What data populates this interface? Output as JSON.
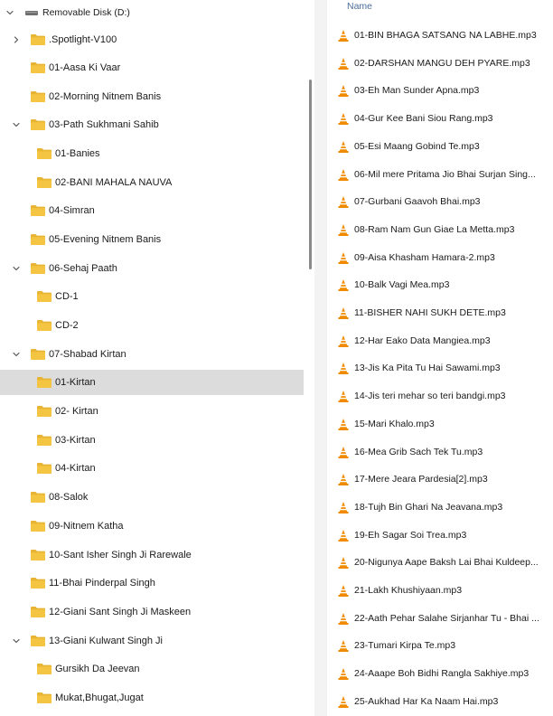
{
  "colors": {
    "folder_yellow": "#f4c542",
    "folder_tab": "#e8b433",
    "selection_bg": "#dcdcdc",
    "vlc_orange": "#f08a00",
    "header_text": "#4a6e9a"
  },
  "nav": {
    "items": [
      {
        "label": "Removable Disk (D:)",
        "icon": "drive-icon",
        "chevron": "expanded"
      },
      {
        "label": ".Spotlight-V100",
        "icon": "folder-icon",
        "chevron": "collapsed"
      },
      {
        "label": "01-Aasa Ki Vaar",
        "icon": "folder-icon",
        "chevron": "none"
      },
      {
        "label": "02-Morning Nitnem Banis",
        "icon": "folder-icon",
        "chevron": "none"
      },
      {
        "label": "03-Path Sukhmani Sahib",
        "icon": "folder-icon",
        "chevron": "expanded"
      },
      {
        "label": "01-Banies",
        "icon": "folder-icon",
        "chevron": "none"
      },
      {
        "label": "02-BANI MAHALA NAUVA",
        "icon": "folder-icon",
        "chevron": "none"
      },
      {
        "label": "04-Simran",
        "icon": "folder-icon",
        "chevron": "none"
      },
      {
        "label": "05-Evening Nitnem Banis",
        "icon": "folder-icon",
        "chevron": "none"
      },
      {
        "label": "06-Sehaj Paath",
        "icon": "folder-icon",
        "chevron": "expanded"
      },
      {
        "label": "CD-1",
        "icon": "folder-icon",
        "chevron": "none"
      },
      {
        "label": "CD-2",
        "icon": "folder-icon",
        "chevron": "none"
      },
      {
        "label": "07-Shabad Kirtan",
        "icon": "folder-icon",
        "chevron": "expanded"
      },
      {
        "label": "01-Kirtan",
        "icon": "folder-icon",
        "chevron": "none",
        "selected": true
      },
      {
        "label": "02- Kirtan",
        "icon": "folder-icon",
        "chevron": "none"
      },
      {
        "label": "03-Kirtan",
        "icon": "folder-icon",
        "chevron": "none"
      },
      {
        "label": "04-Kirtan",
        "icon": "folder-icon",
        "chevron": "none"
      },
      {
        "label": "08-Salok",
        "icon": "folder-icon",
        "chevron": "none"
      },
      {
        "label": "09-Nitnem Katha",
        "icon": "folder-icon",
        "chevron": "none"
      },
      {
        "label": "10-Sant Isher Singh Ji Rarewale",
        "icon": "folder-icon",
        "chevron": "none"
      },
      {
        "label": "11-Bhai Pinderpal Singh",
        "icon": "folder-icon",
        "chevron": "none"
      },
      {
        "label": "12-Giani Sant Singh Ji Maskeen",
        "icon": "folder-icon",
        "chevron": "none"
      },
      {
        "label": "13-Giani Kulwant Singh Ji",
        "icon": "folder-icon",
        "chevron": "expanded"
      },
      {
        "label": "Gursikh Da Jeevan",
        "icon": "folder-icon",
        "chevron": "none"
      },
      {
        "label": "Mukat,Bhugat,Jugat",
        "icon": "folder-icon",
        "chevron": "none"
      }
    ]
  },
  "files": {
    "column_name": "Name",
    "icon": "vlc-icon",
    "items": [
      "01-BIN BHAGA SATSANG NA LABHE.mp3",
      "02-DARSHAN MANGU DEH PYARE.mp3",
      "03-Eh Man Sunder Apna.mp3",
      "04-Gur Kee Bani Siou Rang.mp3",
      "05-Esi Maang Gobind Te.mp3",
      "06-Mil mere Pritama Jio  Bhai Surjan Sing...",
      "07-Gurbani Gaavoh Bhai.mp3",
      "08-Ram Nam Gun Giae La Metta.mp3",
      "09-Aisa Khasham Hamara-2.mp3",
      "10-Balk Vagi Mea.mp3",
      "11-BISHER NAHI SUKH DETE.mp3",
      "12-Har Eako Data Mangiea.mp3",
      "13-Jis Ka Pita Tu Hai Sawami.mp3",
      "14-Jis teri mehar so teri bandgi.mp3",
      "15-Mari Khalo.mp3",
      "16-Mea Grib Sach Tek Tu.mp3",
      "17-Mere Jeara Pardesia[2].mp3",
      "18-Tujh Bin Ghari Na Jeavana.mp3",
      "19-Eh Sagar Soi Trea.mp3",
      "20-Nigunya Aape Baksh Lai Bhai Kuldeep...",
      "21-Lakh Khushiyaan.mp3",
      "22-Aath Pehar Salahe Sirjanhar Tu - Bhai ...",
      "23-Tumari Kirpa Te.mp3",
      "24-Aaape Boh Bidhi Rangla Sakhiye.mp3",
      "25-Aukhad Har Ka Naam Hai.mp3"
    ]
  }
}
